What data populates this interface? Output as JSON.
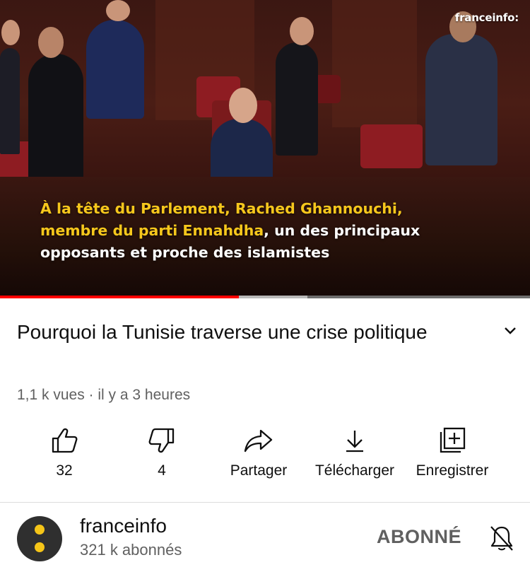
{
  "player": {
    "watermark": "franceinfo:",
    "caption": {
      "highlight_line1": "À la tête du Parlement, Rached Ghannouchi,",
      "highlight_line2": "membre du parti Ennahdha",
      "line2_rest": ", un des principaux",
      "line3": "opposants et proche des islamistes"
    },
    "progress_fraction": 0.45,
    "buffered_fraction": 0.58
  },
  "video": {
    "title": "Pourquoi la Tunisie traverse une crise politique",
    "meta": "1,1 k vues · il y a 3 heures"
  },
  "actions": {
    "like_count": "32",
    "dislike_count": "4",
    "share_label": "Partager",
    "download_label": "Télécharger",
    "save_label": "Enregistrer"
  },
  "channel": {
    "name": "franceinfo",
    "subscribers": "321 k abonnés",
    "subscribed_label": "ABONNÉ"
  },
  "icons": {
    "expand": "chevron-down-icon",
    "like": "thumbs-up-icon",
    "dislike": "thumbs-down-icon",
    "share": "share-arrow-icon",
    "download": "download-icon",
    "save": "add-to-playlist-icon",
    "notifications": "bell-off-icon"
  },
  "colors": {
    "progress": "#ff0000",
    "caption_highlight": "#f6c71c",
    "avatar_bg": "#2f2f2f",
    "avatar_dots": "#f5c518"
  }
}
